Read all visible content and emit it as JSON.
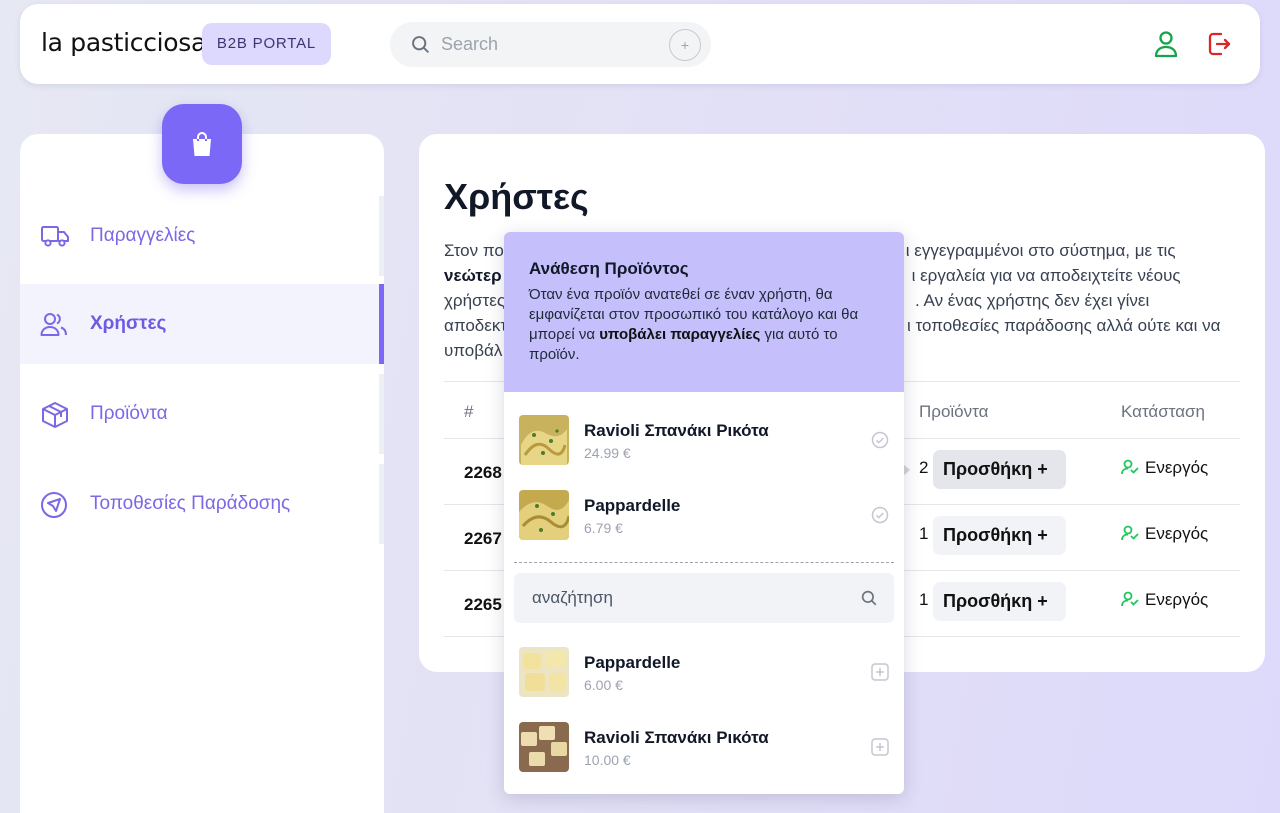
{
  "header": {
    "brand": "la pasticciosa",
    "badge": "B2B PORTAL",
    "search_placeholder": "Search",
    "search_plus": "+",
    "icons": [
      "search-icon",
      "user-icon",
      "logout-icon"
    ]
  },
  "sidebar": {
    "items": [
      {
        "label": "Παραγγελίες",
        "icon": "truck-icon"
      },
      {
        "label": "Χρήστες",
        "icon": "users-icon",
        "active": true
      },
      {
        "label": "Προϊόντα",
        "icon": "box-icon"
      },
      {
        "label": "Τοποθεσίες Παράδοσης",
        "icon": "location-icon"
      }
    ]
  },
  "main": {
    "title": "Χρήστες",
    "desc": {
      "p1": "Στον πο",
      "p1b": "ι εγγεγραμμένοι στο σύστημα, με τις",
      "p2": "νεώτερ",
      "p2b": "ι εργαλεία για να αποδειχτείτε νέους",
      "p3": "χρήστες",
      "p3b": ". Αν ένας χρήστης δεν έχει γίνει",
      "p4": "αποδεκτ",
      "p4b": "ι τοποθεσίες παράδοσης αλλά ούτε και να",
      "p5": "υποβάλ"
    },
    "table": {
      "headers": [
        "#",
        "Προϊόντα",
        "Κατάσταση"
      ],
      "rows": [
        {
          "id": "2268",
          "count": "2",
          "add": "Προσθήκη +",
          "status": "Ενεργός"
        },
        {
          "id": "2267",
          "count": "1",
          "add": "Προσθήκη +",
          "status": "Ενεργός"
        },
        {
          "id": "2265",
          "count": "1",
          "add": "Προσθήκη +",
          "status": "Ενεργός"
        }
      ]
    }
  },
  "popover": {
    "title": "Ανάθεση Προϊόντος",
    "text_1": "Όταν ένα προϊόν ανατεθεί σε έναν χρήστη, θα εμφανίζεται στον προσωπικό του κατάλογο και θα μπορεί να ",
    "text_bold": "υποβάλει παραγγελίες",
    "text_2": " για αυτό το προϊόν.",
    "assigned": [
      {
        "name": "Ravioli Σπανάκι Ρικότα",
        "price": "24.99 €"
      },
      {
        "name": "Pappardelle",
        "price": "6.79 €"
      }
    ],
    "search_placeholder": "αναζήτηση",
    "available": [
      {
        "name": "Pappardelle",
        "price": "6.00 €"
      },
      {
        "name": "Ravioli Σπανάκι Ρικότα",
        "price": "10.00 €"
      }
    ]
  },
  "colors": {
    "accent": "#7b68f6",
    "popover_header": "#c5bffb",
    "status_green": "#22c55e",
    "logout_red": "#dc2626"
  }
}
